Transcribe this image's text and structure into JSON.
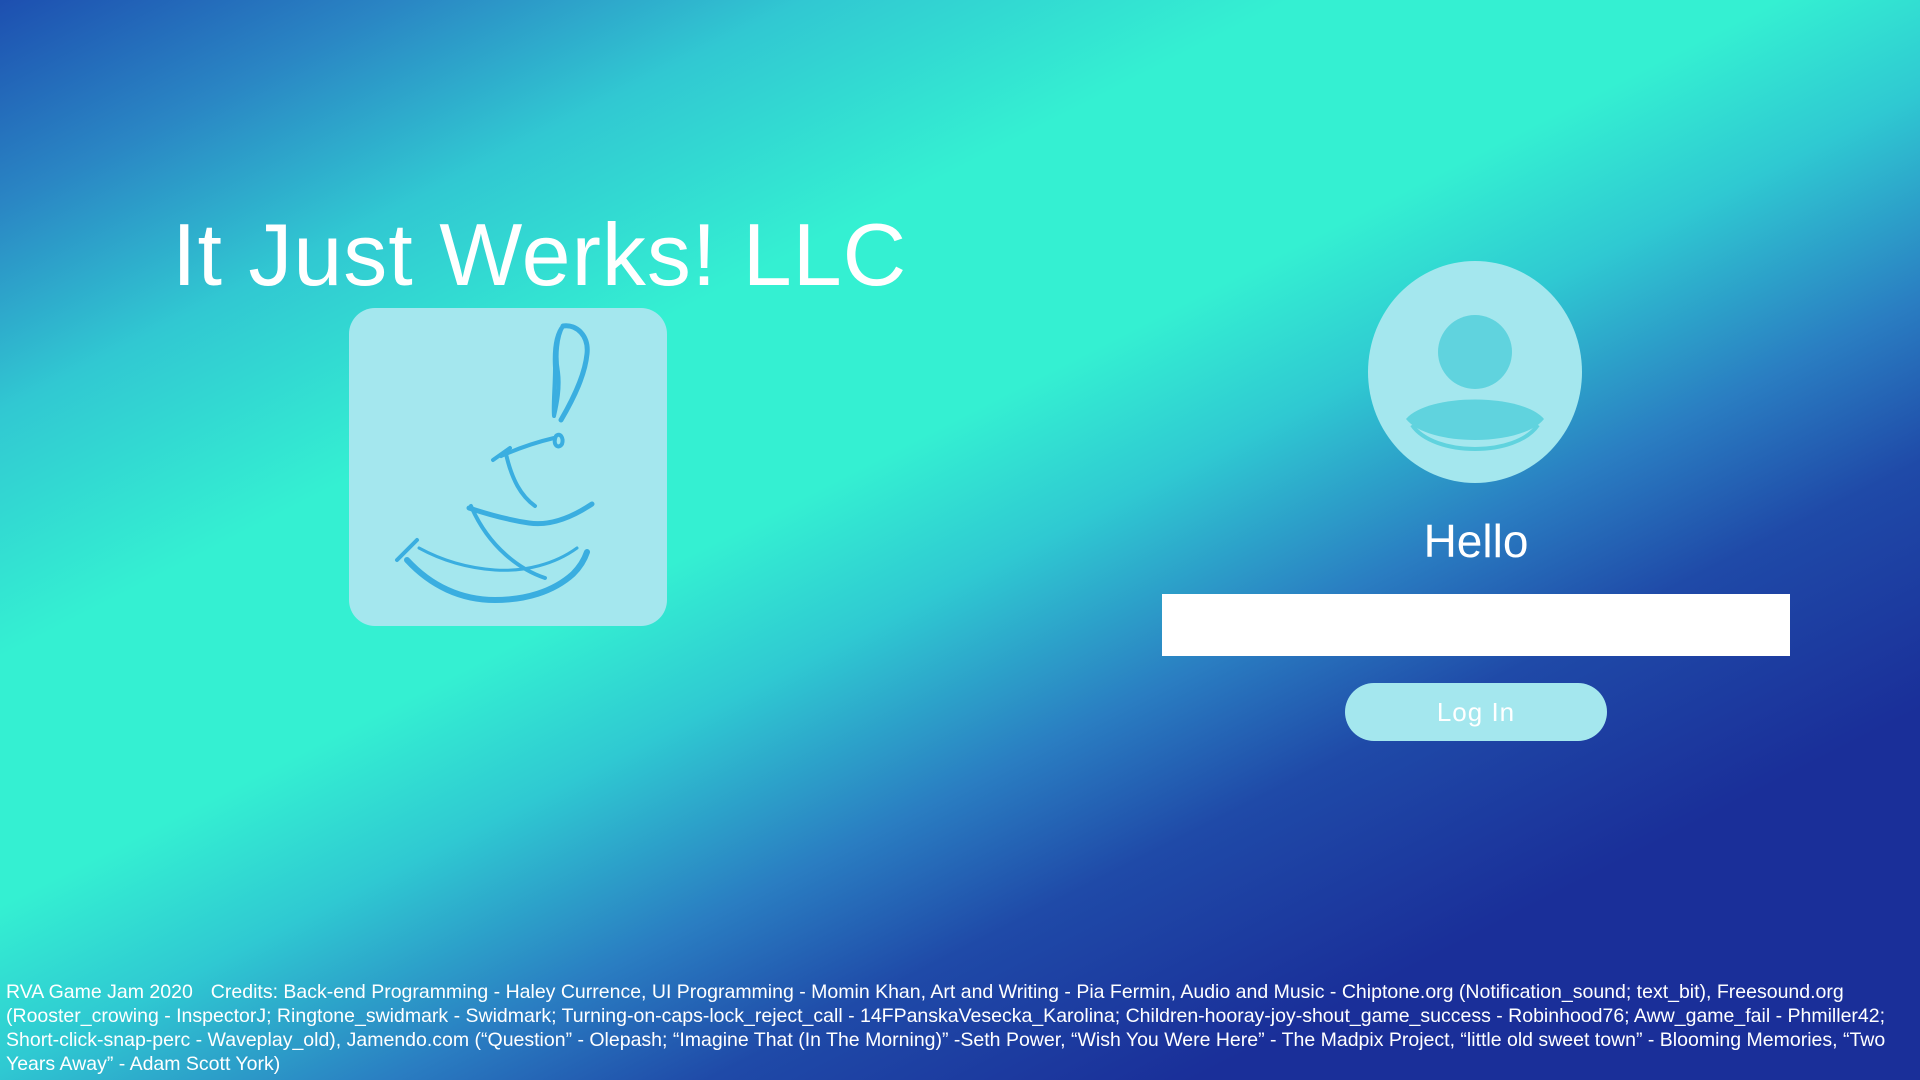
{
  "header": {
    "company_name": "It Just Werks! LLC"
  },
  "login": {
    "greeting": "Hello",
    "username_value": "",
    "login_button_label": "Log In"
  },
  "icons": {
    "logo": "broom-exclamation-logo",
    "avatar": "user-avatar-icon"
  },
  "colors": {
    "tile_background": "#a4e7ee",
    "logo_stroke": "#3aaee0",
    "avatar_figure": "#60d3de",
    "input_background": "#ffffff",
    "text": "#ffffff",
    "gradient_teal": "#34f0d2",
    "gradient_blue": "#1a2f99"
  },
  "footer": {
    "event": "RVA Game Jam 2020",
    "credits": "Credits: Back-end Programming - Haley Currence, UI Programming - Momin Khan, Art and Writing - Pia Fermin, Audio and Music - Chiptone.org (Notification_sound; text_bit), Freesound.org (Rooster_crowing - InspectorJ; Ringtone_swidmark - Swidmark; Turning-on-caps-lock_reject_call - 14FPanskaVesecka_Karolina; Children-hooray-joy-shout_game_success - Robinhood76; Aww_game_fail - Phmiller42; Short-click-snap-perc - Waveplay_old), Jamendo.com (“Question” - Olepash; “Imagine That (In The Morning)” -Seth Power, “Wish You Were Here” - The Madpix Project, “little old sweet town” - Blooming Memories, “Two Years Away” - Adam Scott York)"
  }
}
